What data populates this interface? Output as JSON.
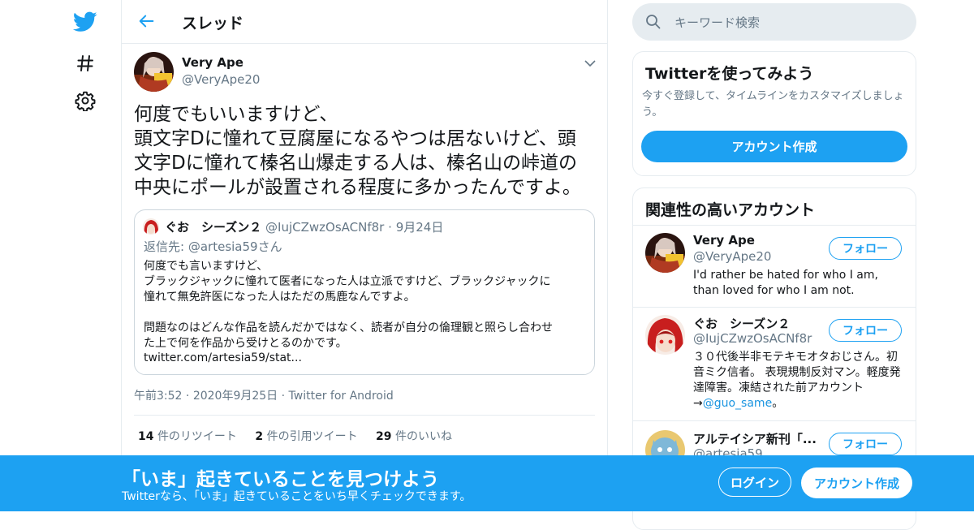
{
  "colors": {
    "brand": "#1da1f2",
    "link": "#1b95e0",
    "text_primary": "#14171a",
    "text_secondary": "#657786",
    "border": "#e6ecf0"
  },
  "nav": {
    "icons": [
      "twitter-logo-icon",
      "hashtag-icon",
      "gear-icon"
    ],
    "hashtag_glyph": "#"
  },
  "header": {
    "back_icon": "arrow-left-icon",
    "title": "スレッド"
  },
  "tweet": {
    "author_name": "Very Ape",
    "author_handle": "@VeryApe20",
    "lines": [
      "何度でもいいますけど、",
      "頭文字Dに憧れて豆腐屋になるやつは居ないけど、頭",
      "文字Dに憧れて榛名山爆走する人は、榛名山の峠道の",
      "中央にポールが設置される程度に多かったんですよ。"
    ],
    "time": "午前3:52",
    "date": "2020年9月25日",
    "client": "Twitter for Android",
    "separator": "·",
    "stats": {
      "retweets": {
        "count": "14",
        "label": "件のリツイート"
      },
      "quotes": {
        "count": "2",
        "label": "件の引用ツイート"
      },
      "likes": {
        "count": "29",
        "label": "件のいいね"
      }
    }
  },
  "quote": {
    "name": "ぐお　シーズン２",
    "handle": "@IujCZwzOsACNf8r",
    "separator": "·",
    "date": "9月24日",
    "reply_prefix": "返信先:",
    "reply_handle": "@artesia59",
    "reply_suffix": "さん",
    "body_lines": [
      "何度でも言いますけど、",
      "ブラックジャックに憧れて医者になった人は立派ですけど、ブラックジャックに",
      "憧れて無免許医になった人はただの馬鹿なんですよ。"
    ],
    "body_lines_2": [
      "問題なのはどんな作品を読んだかではなく、読者が自分の倫理観と照らし合わせ",
      "た上で何を作品から受けとるのかです。"
    ],
    "link": "twitter.com/artesia59/stat..."
  },
  "search": {
    "placeholder": "キーワード検索",
    "icon": "search-icon"
  },
  "signup_card": {
    "title": "Twitterを使ってみよう",
    "description": "今すぐ登録して、タイムラインをカスタマイズしましょう。",
    "button": "アカウント作成"
  },
  "related": {
    "title": "関連性の高いアカウント",
    "follow_label": "フォロー",
    "accounts": [
      {
        "name": "Very Ape",
        "handle": "@VeryApe20",
        "bio": "I'd rather be hated for who I am, than loved for who I am not."
      },
      {
        "name": "ぐお　シーズン２",
        "handle": "@IujCZwzOsACNf8r",
        "bio": "３０代後半非モテキモオタおじさん。初音ミク信者。 表現規制反対マン。軽度発達障害。凍結された前アカウント→",
        "bio_link": "@guo_same",
        "bio_end": "。"
      },
      {
        "name": "アルテイシア新刊「...",
        "handle": "@artesia59"
      }
    ]
  },
  "banner": {
    "title": "「いま」起きていることを見つけよう",
    "subtitle": "Twitterなら、「いま」起きていることをいち早くチェックできます。",
    "login": "ログイン",
    "signup": "アカウント作成"
  }
}
